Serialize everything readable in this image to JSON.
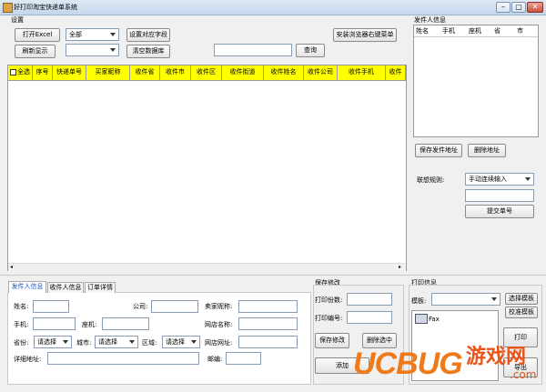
{
  "window": {
    "title": "好打印淘宝快递单系统",
    "minimize": "–",
    "maximize": "▢",
    "close": "✕"
  },
  "settings": {
    "group_label": "设置",
    "open_excel": "打开Excel",
    "filter_select": "全部",
    "set_fields": "设置对应字段",
    "install_browser": "安装浏览器右键菜单",
    "refresh": "刷新显示",
    "clear_db": "清空数据库",
    "search_value": "",
    "search_btn": "查询"
  },
  "grid": {
    "columns": [
      "全选",
      "序号",
      "快递单号",
      "买家昵称",
      "收件省",
      "收件市",
      "收件区",
      "收件街道",
      "收件姓名",
      "收件公司",
      "收件手机",
      "收件"
    ]
  },
  "sender_panel": {
    "title": "发件人信息",
    "columns": [
      "姓名",
      "手机",
      "座机",
      "省",
      "市"
    ],
    "save_btn": "保存发件地址",
    "delete_btn": "删除地址"
  },
  "association": {
    "label": "联想规则:",
    "select": "手动连续输入",
    "input_value": "",
    "submit": "提交单号"
  },
  "tabs": {
    "sender": "发件人信息",
    "receiver": "收件人信息",
    "order": "订单详情"
  },
  "form": {
    "name": "姓名:",
    "company": "公司:",
    "buyer": "卖家昵称:",
    "mobile": "手机:",
    "phone": "座机:",
    "shop": "网店名称:",
    "province": "省份:",
    "province_val": "请选择",
    "city": "城市:",
    "city_val": "请选择",
    "district": "区域:",
    "district_val": "请选择",
    "website": "网店网址:",
    "address": "详细地址:",
    "zip": "邮编:"
  },
  "save_panel": {
    "title": "保存修改",
    "copies": "打印份数:",
    "code": "打印编号:",
    "save": "保存修改",
    "delete": "删除选中",
    "add": "添加"
  },
  "print_panel": {
    "title": "打印信息",
    "template": "模板:",
    "select_tpl": "选择模板",
    "calib_tpl": "校准模板",
    "printer": "Fax",
    "print": "打印",
    "export": "导出"
  },
  "watermark": {
    "logo": "UCBUG",
    "site": "游戏网",
    "domain": ".com"
  }
}
